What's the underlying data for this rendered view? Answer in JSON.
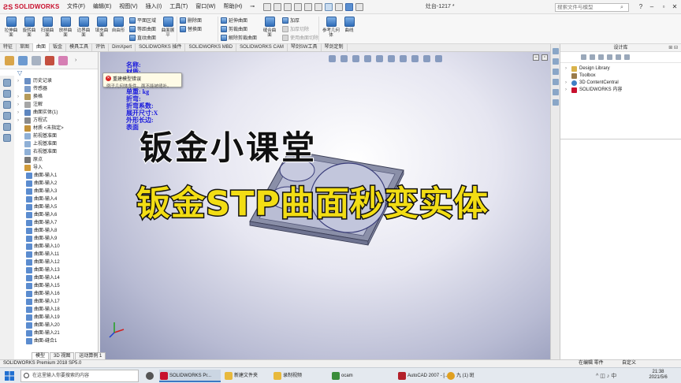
{
  "app": {
    "brand": "SOLIDWORKS",
    "doc_title": "灶台-1217 *"
  },
  "menu": [
    "文件(F)",
    "编辑(E)",
    "视图(V)",
    "插入(I)",
    "工具(T)",
    "窗口(W)",
    "帮助(H)"
  ],
  "search": {
    "placeholder": "搜索文件与模型"
  },
  "ribbon": {
    "big_buttons": [
      "拉伸曲面",
      "旋转曲面",
      "扫描曲面",
      "放样曲面",
      "边界曲面",
      "填充曲面",
      "自由形"
    ],
    "col1": [
      "平面区域",
      "等距曲面",
      "直纹曲面"
    ],
    "surface_flatten": "曲面展平",
    "col2": [
      "删除面",
      "替换面"
    ],
    "col3": [
      "延伸曲面",
      "剪裁曲面",
      "解除剪裁曲面"
    ],
    "knit": "缝合曲面",
    "col4": [
      "加厚",
      "加厚切除",
      "使用曲面切除"
    ],
    "ref_geom": "参考几何体",
    "curves": "曲线"
  },
  "tabs": [
    "特征",
    "草图",
    "曲面",
    "钣金",
    "模具工具",
    "评估",
    "DimXpert",
    "SOLIDWORKS 插件",
    "SOLIDWORKS MBD",
    "SOLIDWORKS CAM",
    "琴剑SW工具",
    "琴剑定制"
  ],
  "active_tab_index": 2,
  "error_popup": {
    "title": "重建模型错误",
    "text": "例子几何体条件。面不能被缝补。"
  },
  "tree": [
    {
      "label": "历史记录",
      "arrow": "›"
    },
    {
      "label": "传感器",
      "arrow": ""
    },
    {
      "label": "换格",
      "arrow": "›"
    },
    {
      "label": "注解",
      "arrow": "›"
    },
    {
      "label": "曲面实体(1)",
      "arrow": "›"
    },
    {
      "label": "方程式",
      "arrow": "›"
    },
    {
      "label": "材质 <未指定>",
      "arrow": ""
    },
    {
      "label": "前视基准面",
      "arrow": ""
    },
    {
      "label": "上视基准面",
      "arrow": ""
    },
    {
      "label": "右视基准面",
      "arrow": ""
    },
    {
      "label": "原点",
      "arrow": ""
    },
    {
      "label": "导入",
      "arrow": ""
    }
  ],
  "tree_surfaces": [
    "曲面-输入1",
    "曲面-输入2",
    "曲面-输入3",
    "曲面-输入4",
    "曲面-输入5",
    "曲面-输入6",
    "曲面-输入7",
    "曲面-输入8",
    "曲面-输入9",
    "曲面-输入10",
    "曲面-输入11",
    "曲面-输入12",
    "曲面-输入13",
    "曲面-输入14",
    "曲面-输入15",
    "曲面-输入16",
    "曲面-输入17",
    "曲面-输入18",
    "曲面-输入19",
    "曲面-输入20",
    "曲面-输入21",
    "曲面-缝合1"
  ],
  "props": [
    "名称:",
    "材质:",
    "单重: kg",
    "折弯:",
    "折弯系数:",
    "展开尺寸:X",
    "外形长边:",
    "表面"
  ],
  "overlay": {
    "line1": "钣金小课堂",
    "line2": "钣金STP曲面秒变实体"
  },
  "task_pane": {
    "title": "设计库",
    "items": [
      "Design Library",
      "Toolbox",
      "3D ContentCentral",
      "SOLIDWORKS 内容"
    ]
  },
  "model_tabs": [
    "模型",
    "3D 视图",
    "运动算例 1"
  ],
  "status": {
    "left": "SOLIDWORKS Premium 2018 SP5.0",
    "editing": "在编辑 零件",
    "custom": "自定义"
  },
  "taskbar": {
    "search": "在这里输入你要搜索的内容",
    "apps": [
      "SOLIDWORKS Pr...",
      "新建文件夹",
      "录制视频",
      "ocam",
      "AutoCAD 2007 - [...",
      "九 (1) 斑"
    ],
    "time": "21:38",
    "date": "2021/5/6"
  },
  "colors": {
    "accent": "#3b78c4",
    "brand_red": "#c8102e",
    "prop_text": "#1a1adc",
    "overlay_yellow": "#f2dd14"
  }
}
